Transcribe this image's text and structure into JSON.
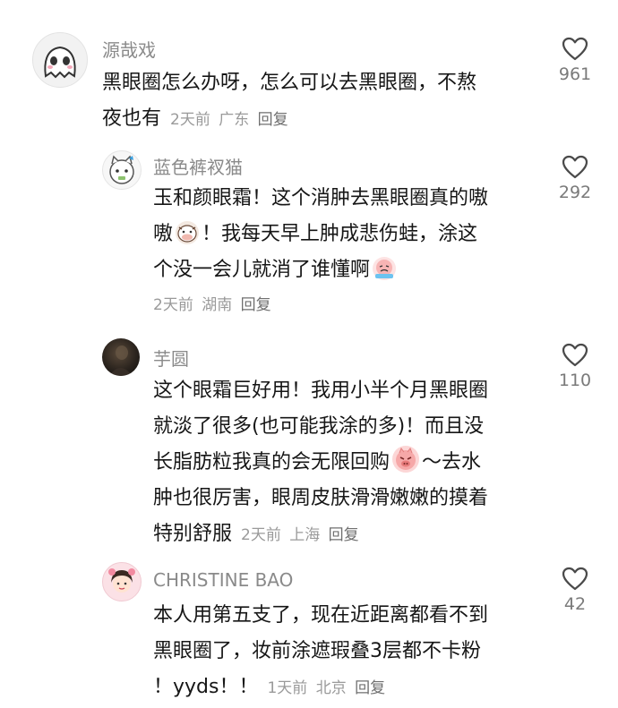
{
  "comments": [
    {
      "username": "源哉戏",
      "text": [
        "黑眼圈怎么办呀，怎么可以去黑眼圈，不熬",
        "夜也有"
      ],
      "time": "2天前",
      "location": "广东",
      "reply": "回复",
      "likes": "961"
    },
    {
      "username": "蓝色裤衩猫",
      "text1": "玉和颜眼霜！这个消肿去黑眼圈真的嗷",
      "text2a": "嗷",
      "text2b": "！我每天早上肿成悲伤蛙，涂这",
      "text3": "个没一会儿就消了谁懂啊",
      "time": "2天前",
      "location": "湖南",
      "reply": "回复",
      "likes": "292"
    },
    {
      "username": "芋圆",
      "text1": "这个眼霜巨好用！我用小半个月黑眼圈",
      "text2": "就淡了很多(也可能我涂的多)！而且没",
      "text3a": "长脂肪粒我真的会无限回购",
      "text3b": "～去水",
      "text4": "肿也很厉害，眼周皮肤滑滑嫩嫩的摸着",
      "text5": "特别舒服",
      "time": "2天前",
      "location": "上海",
      "reply": "回复",
      "likes": "110"
    },
    {
      "username": "CHRISTINE BAO",
      "text1": "本人用第五支了，现在近距离都看不到",
      "text2": "黑眼圈了，妆前涂遮瑕叠3层都不卡粉",
      "text3": "！yyds！！",
      "time": "1天前",
      "location": "北京",
      "reply": "回复",
      "likes": "42"
    }
  ],
  "icons": {
    "like": "heart-outline-icon",
    "emoji_cow": "cow-emoji",
    "emoji_crying": "crying-emoji",
    "emoji_angry_pig": "angry-pig-emoji"
  },
  "colors": {
    "text": "#161616",
    "username": "#8a8a8a",
    "meta": "#9a9a9a",
    "heart": "#4a4a4a"
  }
}
